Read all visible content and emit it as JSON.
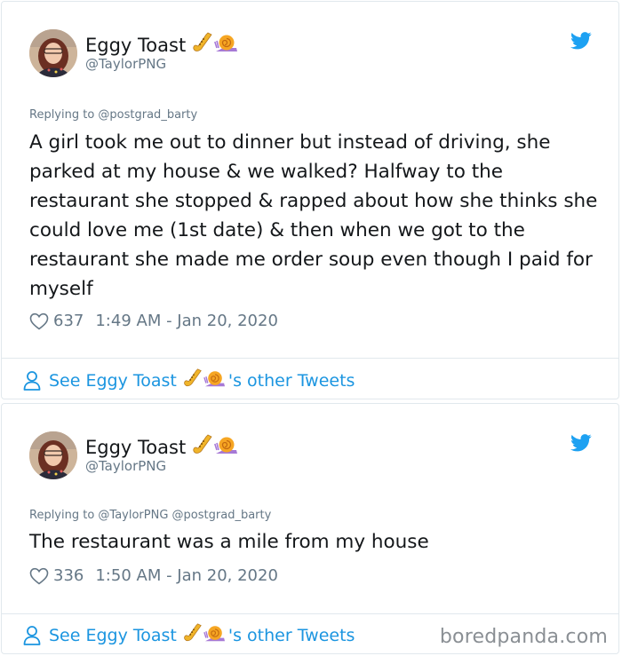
{
  "tweets": [
    {
      "author": {
        "name": "Eggy Toast",
        "name_emoji": [
          "saxophone-emoji",
          "snail-emoji"
        ],
        "handle": "@TaylorPNG"
      },
      "replying_to": "Replying to @postgrad_barty",
      "text": "A girl took me out to dinner but instead of driving, she parked at my house & we walked? Halfway to the restaurant she stopped & rapped about how she thinks she could love me (1st date) & then when we got to the restaurant she made me order soup even though I paid for myself",
      "likes": "637",
      "timestamp": "1:49 AM - Jan 20, 2020",
      "see_other_prefix": "See Eggy Toast",
      "see_other_suffix": "'s other Tweets"
    },
    {
      "author": {
        "name": "Eggy Toast",
        "name_emoji": [
          "saxophone-emoji",
          "snail-emoji"
        ],
        "handle": "@TaylorPNG"
      },
      "replying_to": "Replying to @TaylorPNG @postgrad_barty",
      "text": "The restaurant was a mile from my house",
      "likes": "336",
      "timestamp": "1:50 AM - Jan 20, 2020",
      "see_other_prefix": "See Eggy Toast",
      "see_other_suffix": "'s other Tweets"
    }
  ],
  "colors": {
    "link": "#1b95e0",
    "secondary_text": "#657786",
    "primary_text": "#14171a",
    "border": "#e1e8ed"
  },
  "watermark": "boredpanda.com"
}
